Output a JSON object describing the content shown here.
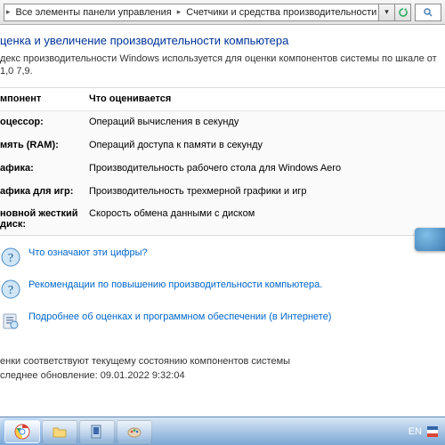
{
  "breadcrumb": {
    "seg1": "Все элементы панели управления",
    "seg2": "Счетчики и средства производительности"
  },
  "page": {
    "title": "ценка и увеличение производительности компьютера",
    "subtitle": "декс производительности Windows используется для оценки компонентов системы по шкале от 1,0\n7,9."
  },
  "table": {
    "head_a": "мпонент",
    "head_b": "Что оценивается",
    "rows": [
      {
        "a": "оцессор:",
        "b": "Операций вычисления в секунду"
      },
      {
        "a": "мять (RAM):",
        "b": "Операций доступа к памяти в секунду"
      },
      {
        "a": "афика:",
        "b": "Производительность рабочего стола для Windows Aero"
      },
      {
        "a": "афика для игр:",
        "b": "Производительность трехмерной графики и игр"
      },
      {
        "a": "новной жесткий диск:",
        "b": "Скорость обмена данными с диском"
      }
    ]
  },
  "links": {
    "l1": "Что означают эти цифры?",
    "l2": "Рекомендации по повышению производительности компьютера.",
    "l3": "Подробнее об оценках и программном обеспечении (в Интернете)"
  },
  "status": {
    "line1": "енки соответствуют текущему состоянию компонентов системы",
    "line2": "следнее обновление: 09.01.2022 9:32:04"
  },
  "tray": {
    "lang": "EN"
  }
}
